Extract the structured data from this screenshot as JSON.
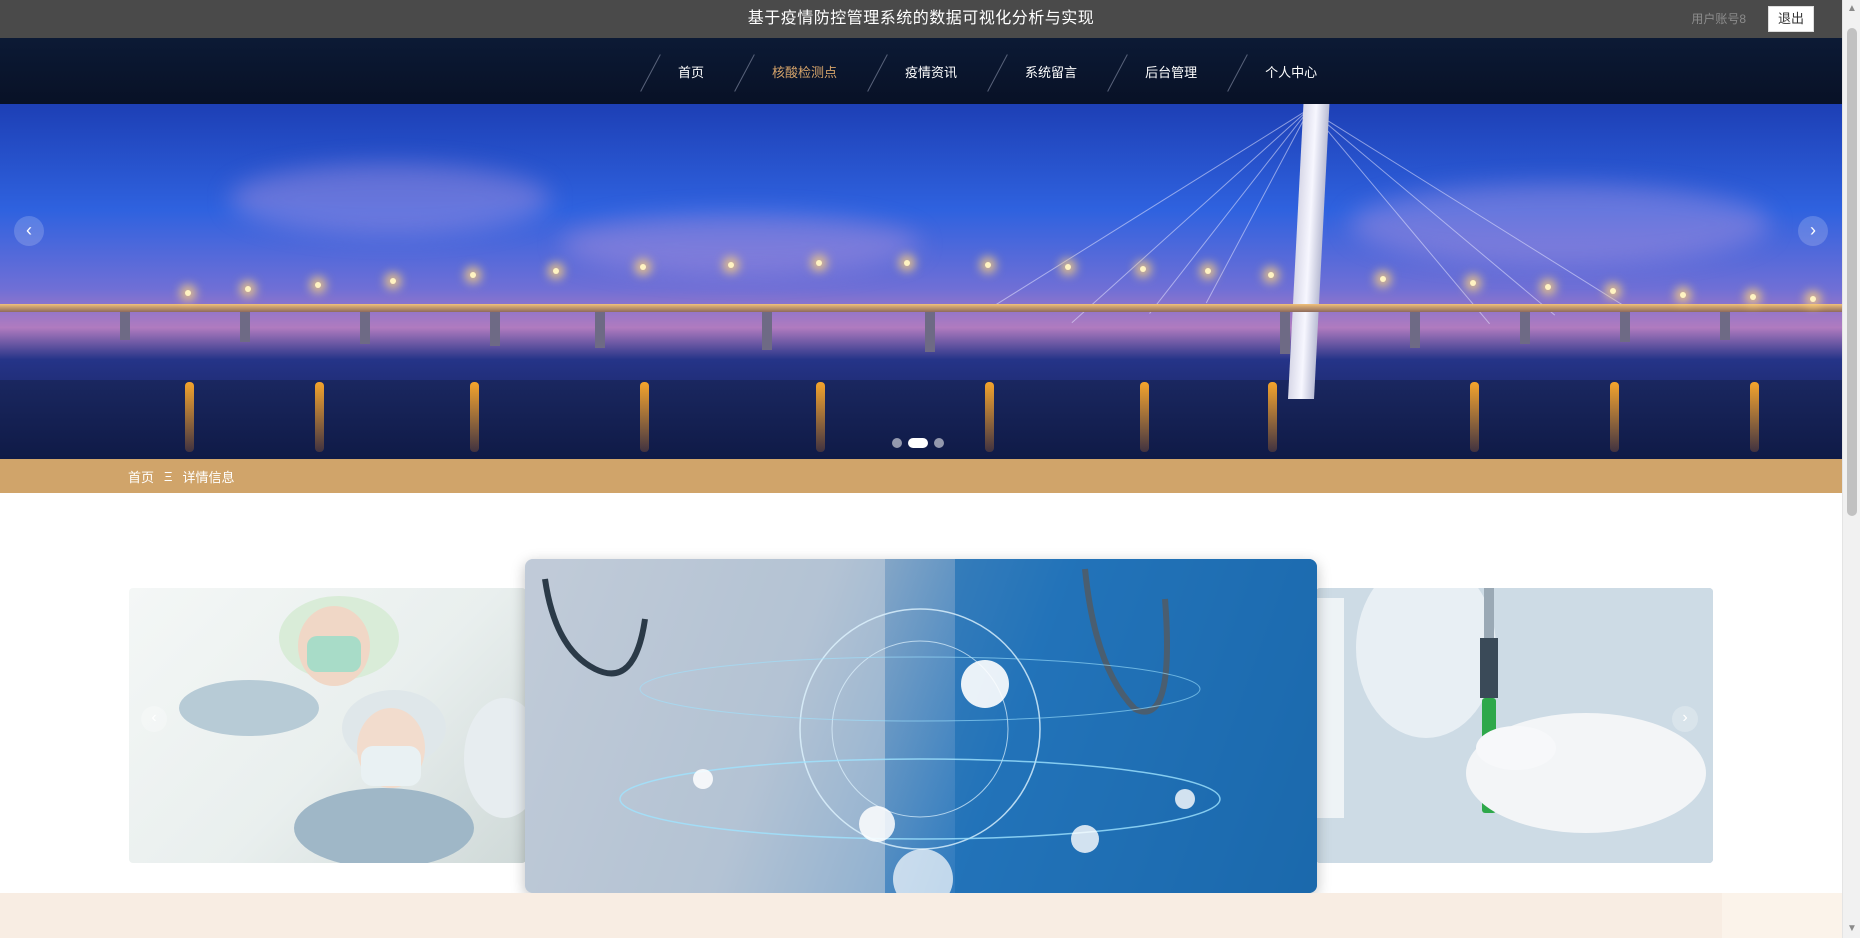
{
  "header": {
    "title": "基于疫情防控管理系统的数据可视化分析与实现",
    "user_label": "用户账号8",
    "logout_label": "退出"
  },
  "nav": {
    "items": [
      {
        "label": "首页"
      },
      {
        "label": "核酸检测点"
      },
      {
        "label": "疫情资讯"
      },
      {
        "label": "系统留言"
      },
      {
        "label": "后台管理"
      },
      {
        "label": "个人中心"
      }
    ],
    "active_index": 1
  },
  "hero": {
    "prev_label": "‹",
    "next_label": "›",
    "slide_count": 3,
    "active_slide": 1
  },
  "breadcrumb": {
    "home": "首页",
    "separator": "Ξ",
    "current": "详情信息"
  },
  "carousel": {
    "prev_label": "‹",
    "next_label": "›"
  },
  "colors": {
    "topbar": "#4a4a4a",
    "nav_bg": "#0c1a35",
    "nav_active": "#d6a46a",
    "breadcrumb_bg": "#d0a46a"
  }
}
